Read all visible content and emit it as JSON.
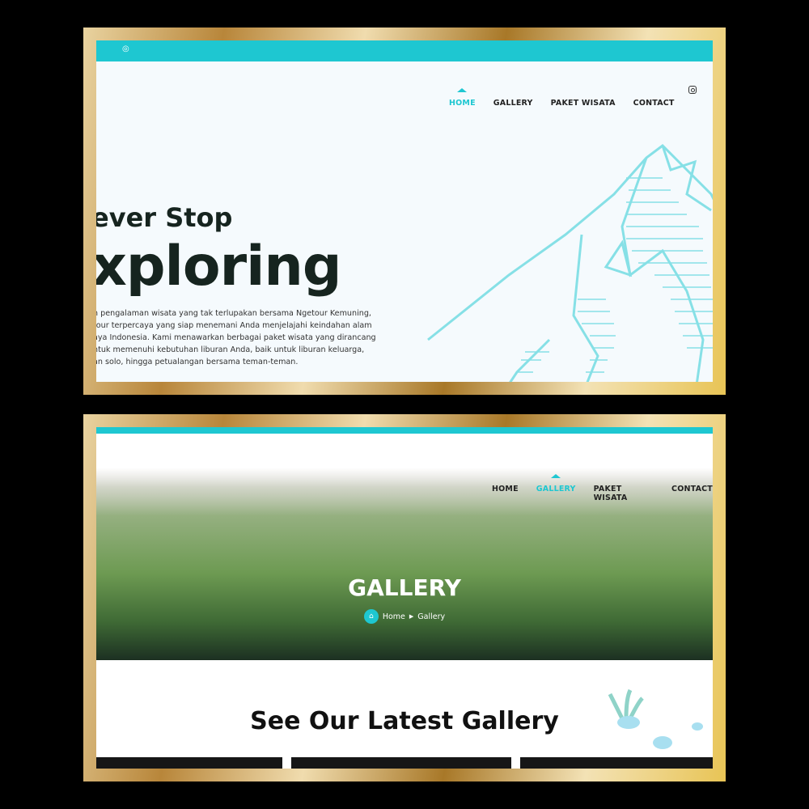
{
  "screen1": {
    "nav": [
      "HOME",
      "GALLERY",
      "PAKET WISATA",
      "CONTACT"
    ],
    "hero_line1": "ever Stop",
    "hero_line2": "xploring",
    "paragraph": [
      "n pengalaman wisata yang tak terlupakan bersama Ngetour Kemuning,",
      "tour terpercaya yang siap menemani Anda menjelajahi keindahan alam",
      "aya Indonesia. Kami menawarkan berbagai paket wisata yang dirancang",
      "ntuk memenuhi kebutuhan liburan Anda, baik untuk liburan keluarga,",
      "an solo, hingga petualangan bersama teman-teman."
    ]
  },
  "screen2": {
    "nav": [
      "HOME",
      "GALLERY",
      "PAKET WISATA",
      "CONTACT"
    ],
    "title": "GALLERY",
    "breadcrumb": {
      "home": "Home",
      "current": "Gallery"
    },
    "section_title": "See Our Latest Gallery"
  },
  "colors": {
    "accent": "#1ec7d1"
  }
}
